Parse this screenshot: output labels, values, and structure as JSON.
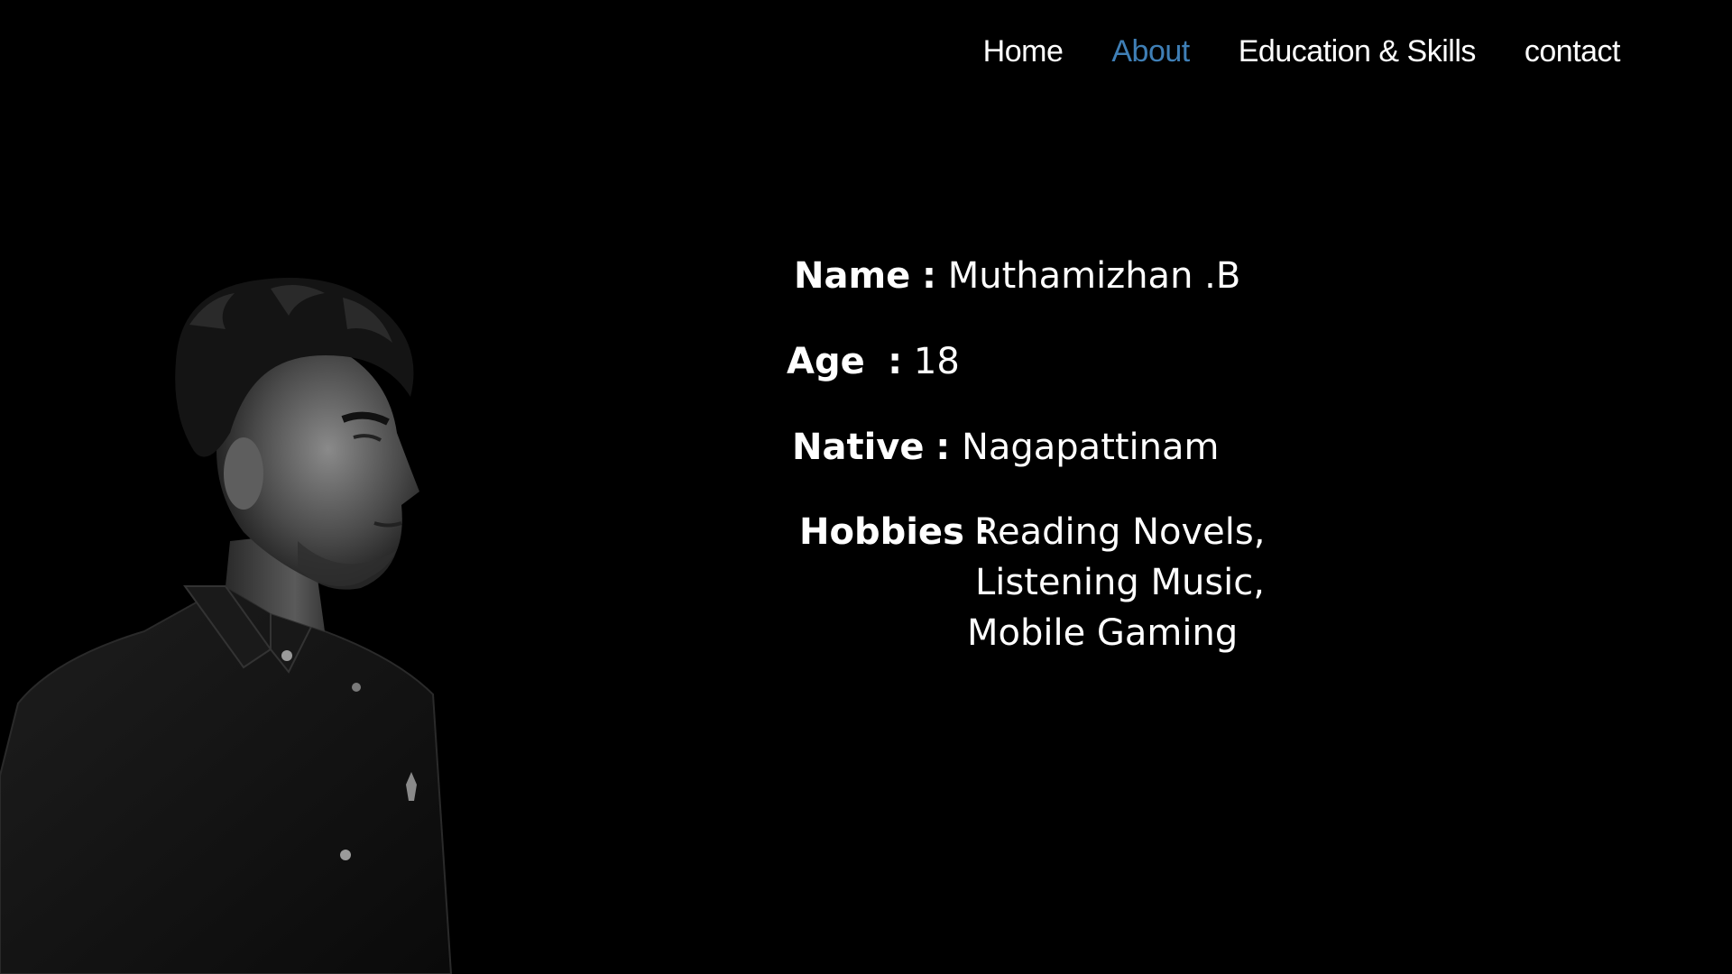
{
  "nav": {
    "items": [
      {
        "label": "Home",
        "active": false
      },
      {
        "label": "About",
        "active": true
      },
      {
        "label": "Education & Skills",
        "active": false
      },
      {
        "label": "contact",
        "active": false
      }
    ],
    "active_color": "#3f7fb6"
  },
  "about": {
    "name": {
      "label": "Name",
      "separator": ":",
      "value": "Muthamizhan .B"
    },
    "age": {
      "label": "Age",
      "separator": ":",
      "value": "18"
    },
    "native": {
      "label": "Native",
      "separator": ":",
      "value": "Nagapattinam"
    },
    "hobbies": {
      "label": "Hobbies",
      "separator": ":",
      "values": [
        "Reading Novels,",
        "Listening Music,",
        "Mobile Gaming"
      ]
    }
  },
  "colors": {
    "background": "#000000",
    "text": "#ffffff"
  }
}
